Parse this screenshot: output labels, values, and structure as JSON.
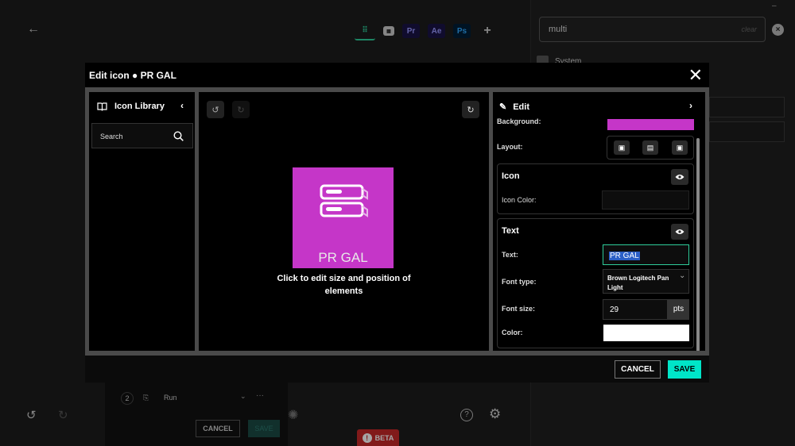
{
  "background": {
    "apps": [
      {
        "icon": "grid-icon",
        "label": "",
        "color": "#2ecc9a"
      },
      {
        "icon": "keyboard-icon",
        "label": "",
        "color": "#cccccc"
      },
      {
        "icon": "premiere-icon",
        "label": "Pr",
        "color": "#9999ff"
      },
      {
        "icon": "after-effects-icon",
        "label": "Ae",
        "color": "#9999ff"
      },
      {
        "icon": "photoshop-icon",
        "label": "Ps",
        "color": "#31a8ff"
      }
    ],
    "search_value": "multi",
    "search_clear": "clear",
    "system_label": "System",
    "action_number": "2",
    "action_label": "Run",
    "cancel_label": "CANCEL",
    "save_label": "SAVE",
    "beta_label": "BETA"
  },
  "modal": {
    "title": "Edit icon ● PR GAL",
    "library": {
      "title": "Icon Library",
      "search_placeholder": "Search"
    },
    "preview": {
      "text": "PR GAL",
      "hint": "Click to edit size and position of elements",
      "background_color": "#c536c8"
    },
    "edit": {
      "title": "Edit",
      "background_label": "Background:",
      "background_color": "#c536c8",
      "layout_label": "Layout:",
      "icon_section": {
        "title": "Icon",
        "color_label": "Icon Color:"
      },
      "text_section": {
        "title": "Text",
        "text_label": "Text:",
        "text_value": "PR GAL",
        "font_type_label": "Font type:",
        "font_type_value": "Brown Logitech Pan Light",
        "font_size_label": "Font size:",
        "font_size_value": "29",
        "font_size_unit": "pts",
        "color_label": "Color:",
        "color_value": "#ffffff"
      }
    },
    "footer": {
      "cancel": "CANCEL",
      "save": "SAVE"
    }
  }
}
